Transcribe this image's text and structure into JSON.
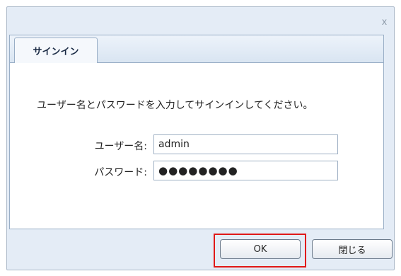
{
  "dialog": {
    "close_glyph": "x",
    "tab_label": "サインイン",
    "instruction": "ユーザー名とパスワードを入力してサインインしてください。",
    "username_label": "ユーザー名:",
    "username_value": "admin",
    "password_label": "パスワード:",
    "password_display": "●●●●●●●●",
    "ok_label": "OK",
    "close_label": "閉じる"
  },
  "colors": {
    "highlight": "#e01818",
    "dialog_bg": "#e4ecf6",
    "border": "#99aec6"
  }
}
